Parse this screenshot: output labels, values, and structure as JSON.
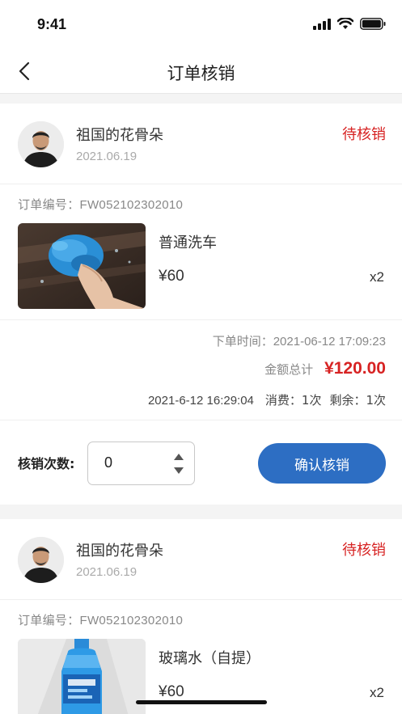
{
  "status_bar": {
    "time": "9:41"
  },
  "nav": {
    "title": "订单核销"
  },
  "orders": [
    {
      "user_name": "祖国的花骨朵",
      "date": "2021.06.19",
      "status": "待核销",
      "order_no_label": "订单编号：",
      "order_no": "FW052102302010",
      "product_name": "普通洗车",
      "price": "¥60",
      "qty": "x2",
      "order_time_label": "下单时间：",
      "order_time": "2021-06-12 17:09:23",
      "total_label": "金额总计",
      "total": "¥120.00",
      "usage_time": "2021-6-12 16:29:04",
      "consumed": "消费：1次",
      "remaining": "剩余：1次",
      "verify_label": "核销次数:",
      "verify_count": "0",
      "confirm_label": "确认核销"
    },
    {
      "user_name": "祖国的花骨朵",
      "date": "2021.06.19",
      "status": "待核销",
      "order_no_label": "订单编号：",
      "order_no": "FW052102302010",
      "product_name": "玻璃水（自提）",
      "price": "¥60",
      "qty": "x2"
    }
  ],
  "colors": {
    "accent": "#2d6ec3",
    "status_red": "#d72323"
  },
  "icons": [
    "back-arrow-icon",
    "signal-icon",
    "wifi-icon",
    "battery-icon",
    "stepper-up-icon",
    "stepper-down-icon"
  ]
}
